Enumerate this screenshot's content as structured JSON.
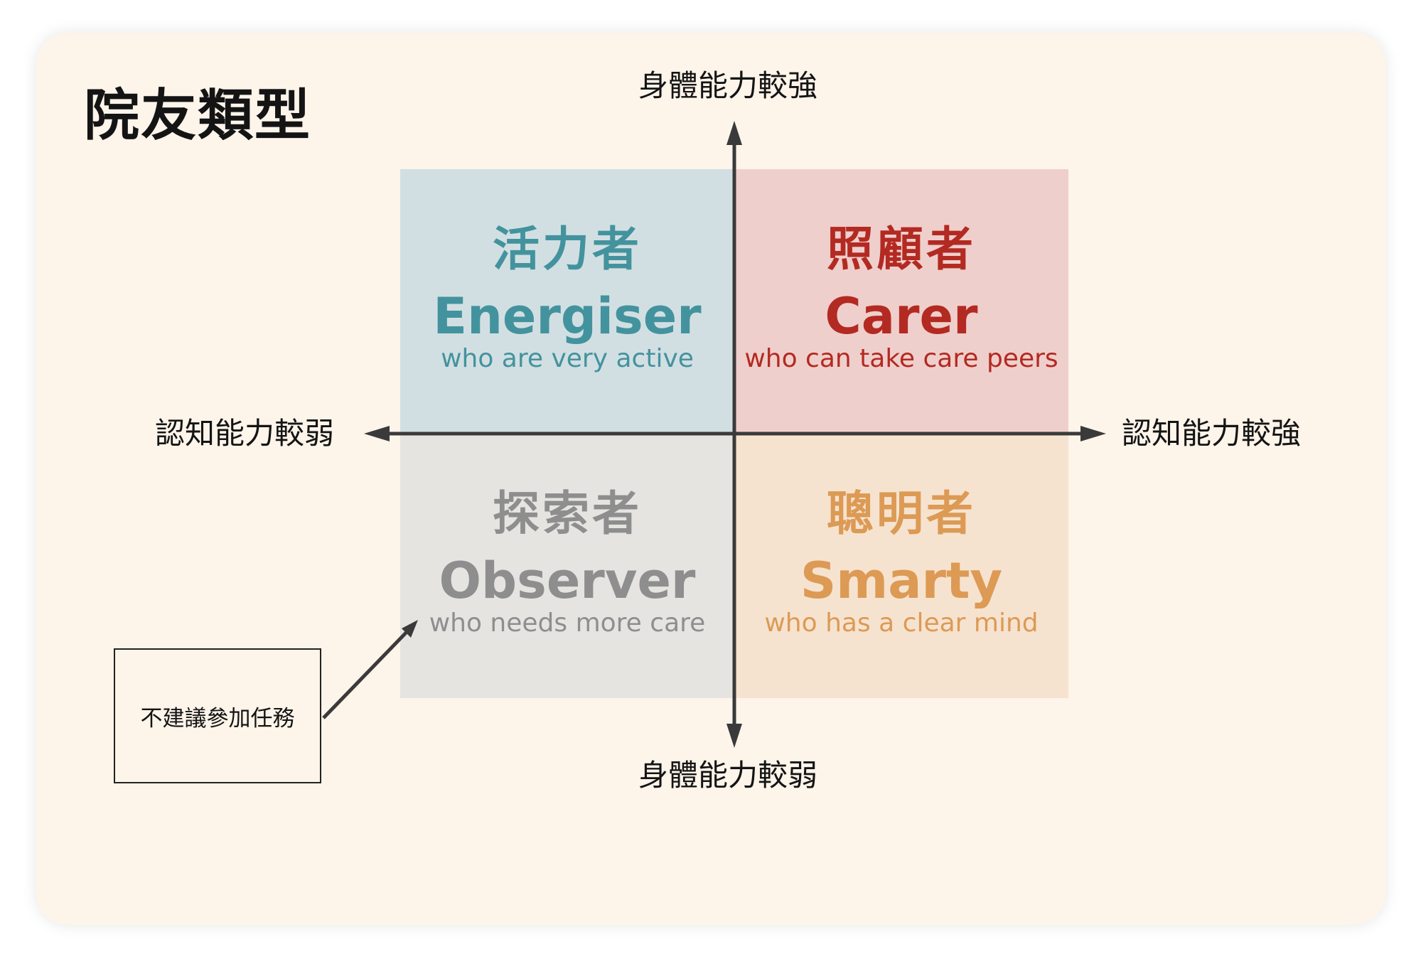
{
  "title": "院友類型",
  "axes": {
    "vertical_top": "身體能力較強",
    "vertical_bottom": "身體能力較弱",
    "horizontal_left": "認知能力較弱",
    "horizontal_right": "認知能力較強"
  },
  "quadrants": {
    "top_left": {
      "zh": "活力者",
      "en": "Energiser",
      "sub": "who are very active",
      "color": "#43939e",
      "bg": "#d2dfe2"
    },
    "top_right": {
      "zh": "照顧者",
      "en": "Carer",
      "sub": "who can take care peers",
      "color": "#b32a22",
      "bg": "#efcfcc"
    },
    "bottom_left": {
      "zh": "探索者",
      "en": "Observer",
      "sub": "who needs more care",
      "color": "#8e8e8e",
      "bg": "#e5e4e1"
    },
    "bottom_right": {
      "zh": "聰明者",
      "en": "Smarty",
      "sub": "who has a clear mind",
      "color": "#dc9a55",
      "bg": "#f6e3cf"
    }
  },
  "callout": {
    "text": "不建議參加任務"
  },
  "colors": {
    "card_background": "#fdf4ea",
    "axis": "#3a3a3a"
  }
}
